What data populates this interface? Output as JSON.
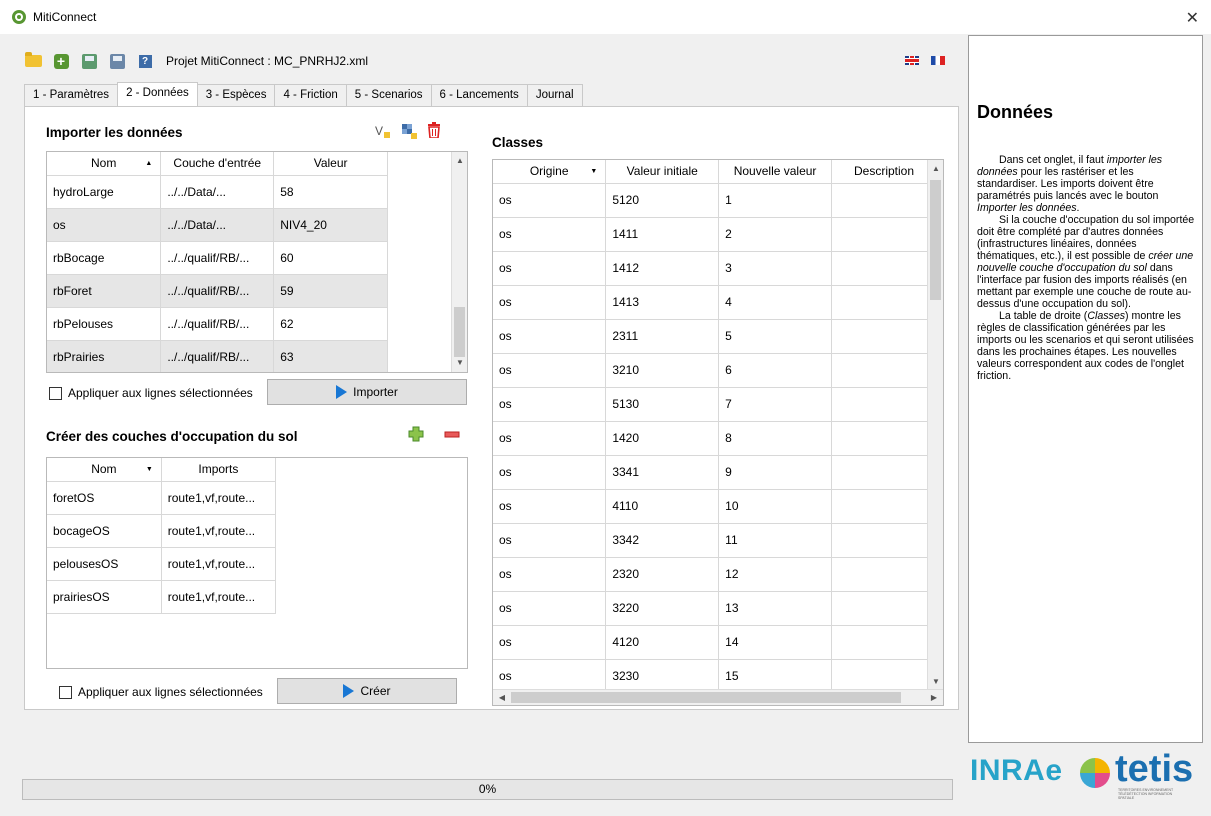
{
  "window": {
    "title": "MitiConnect",
    "close_glyph": "✕"
  },
  "toolbar": {
    "project_label": "Projet MitiConnect : MC_PNRHJ2.xml",
    "icons": [
      "folder-open-icon",
      "new-project-icon",
      "save-as-icon",
      "save-icon",
      "help-icon"
    ]
  },
  "languages": [
    "english-flag",
    "french-flag"
  ],
  "tabs": [
    {
      "label": "1 - Paramètres",
      "active": false
    },
    {
      "label": "2 - Données",
      "active": true
    },
    {
      "label": "3 - Espèces",
      "active": false
    },
    {
      "label": "4 - Friction",
      "active": false
    },
    {
      "label": "5 - Scenarios",
      "active": false
    },
    {
      "label": "6 - Lancements",
      "active": false
    },
    {
      "label": "Journal",
      "active": false
    }
  ],
  "import": {
    "title": "Importer les données",
    "columns": [
      "Nom",
      "Couche d'entrée",
      "Valeur"
    ],
    "rows": [
      [
        "hydroLarge",
        "../../Data/...",
        "58"
      ],
      [
        "os",
        "../../Data/...",
        "NIV4_20"
      ],
      [
        "rbBocage",
        "../../qualif/RB/...",
        "60"
      ],
      [
        "rbForet",
        "../../qualif/RB/...",
        "59"
      ],
      [
        "rbPelouses",
        "../../qualif/RB/...",
        "62"
      ],
      [
        "rbPrairies",
        "../../qualif/RB/...",
        "63"
      ]
    ],
    "apply_selected": "Appliquer aux lignes sélectionnées",
    "button": "Importer"
  },
  "create": {
    "title": "Créer des couches d'occupation du sol",
    "columns": [
      "Nom",
      "Imports"
    ],
    "rows": [
      [
        "foretOS",
        "route1,vf,route..."
      ],
      [
        "bocageOS",
        "route1,vf,route..."
      ],
      [
        "pelousesOS",
        "route1,vf,route..."
      ],
      [
        "prairiesOS",
        "route1,vf,route..."
      ]
    ],
    "apply_selected": "Appliquer aux lignes sélectionnées",
    "button": "Créer"
  },
  "classes": {
    "title": "Classes",
    "columns": [
      "Origine",
      "Valeur initiale",
      "Nouvelle valeur",
      "Description"
    ],
    "rows": [
      [
        "os",
        "5120",
        "1"
      ],
      [
        "os",
        "1411",
        "2"
      ],
      [
        "os",
        "1412",
        "3"
      ],
      [
        "os",
        "1413",
        "4"
      ],
      [
        "os",
        "2311",
        "5"
      ],
      [
        "os",
        "3210",
        "6"
      ],
      [
        "os",
        "5130",
        "7"
      ],
      [
        "os",
        "1420",
        "8"
      ],
      [
        "os",
        "3341",
        "9"
      ],
      [
        "os",
        "4110",
        "10"
      ],
      [
        "os",
        "3342",
        "11"
      ],
      [
        "os",
        "2320",
        "12"
      ],
      [
        "os",
        "3220",
        "13"
      ],
      [
        "os",
        "4120",
        "14"
      ],
      [
        "os",
        "3230",
        "15"
      ]
    ]
  },
  "help": {
    "title": "Données",
    "p1_a": "Dans cet onglet, il faut ",
    "p1_em": "importer les données",
    "p1_b": " pour les rastériser et les standardiser. Les imports doivent être paramétrés puis lancés avec le bouton ",
    "p1_em2": "Importer les données",
    "p1_c": ".",
    "p2_a": "Si la couche d'occupation du sol importée doit être complété par d'autres données (infrastructures linéaires, données thématiques, etc.), il est possible de ",
    "p2_em": "créer une nouvelle couche d'occupation du sol",
    "p2_b": " dans l'interface par fusion des imports réalisés (en mettant par exemple une couche de route au-dessus d'une occupation du sol).",
    "p3_a": "La table de droite (",
    "p3_em": "Classes",
    "p3_b": ") montre les règles de classification générées par les imports ou les scenarios et qui seront utilisées dans les prochaines étapes. Les nouvelles valeurs correspondent aux codes de l'onglet friction."
  },
  "progress": {
    "label": "0%",
    "value": 0
  },
  "logos": {
    "inrae": "INRAe",
    "tetis": "tetis",
    "tetis_subtitle": "TERRITOIRES ENVIRONNEMENT TÉLÉDÉTECTION INFORMATION SPATIALE"
  }
}
